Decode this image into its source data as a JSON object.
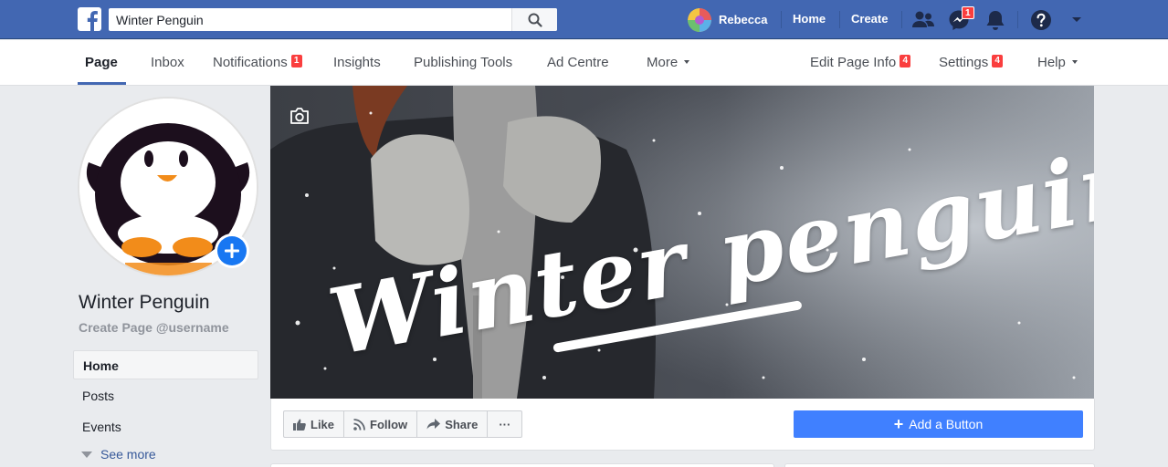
{
  "topbar": {
    "search_value": "Winter Penguin",
    "user_name": "Rebecca",
    "home_label": "Home",
    "create_label": "Create",
    "messenger_badge": "1",
    "colors": {
      "bar": "#4267b2",
      "badge": "#fa3e3e"
    }
  },
  "tabs": {
    "page": "Page",
    "inbox": "Inbox",
    "notifications": "Notifications",
    "notifications_badge": "1",
    "insights": "Insights",
    "publishing_tools": "Publishing Tools",
    "ad_centre": "Ad Centre",
    "more": "More",
    "edit_page_info": "Edit Page Info",
    "edit_page_info_badge": "4",
    "settings": "Settings",
    "settings_badge": "4",
    "help": "Help"
  },
  "sidebar": {
    "page_name": "Winter Penguin",
    "handle": "Create Page @username",
    "items": [
      "Home",
      "Posts",
      "Events"
    ],
    "see_more": "See more"
  },
  "cover": {
    "title": "Winter penguin"
  },
  "actions": {
    "like": "Like",
    "follow": "Follow",
    "share": "Share",
    "more": "···",
    "add_button": "Add a Button",
    "add_button_color": "#4080ff"
  }
}
